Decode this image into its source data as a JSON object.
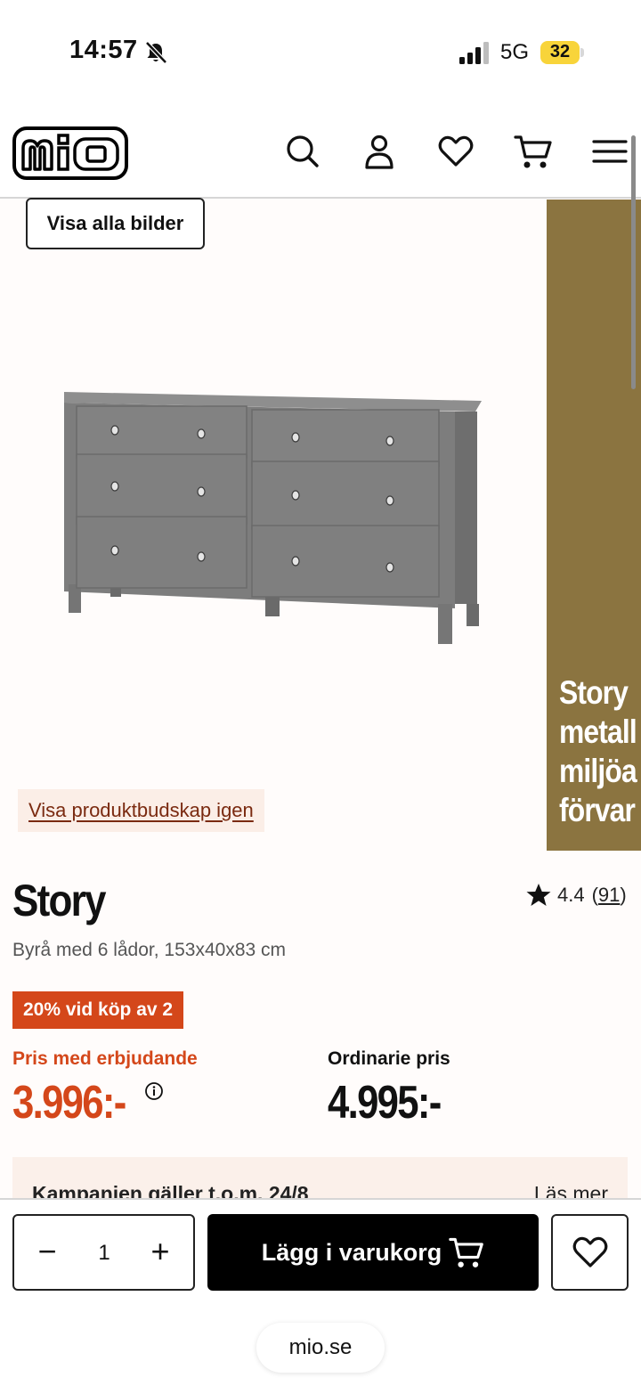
{
  "status_bar": {
    "time": "14:57",
    "network": "5G",
    "battery": "32"
  },
  "header": {
    "logo_text": "mio",
    "icons": [
      "search-icon",
      "account-icon",
      "heart-icon",
      "cart-icon",
      "menu-icon"
    ]
  },
  "gallery": {
    "show_all_label": "Visa alla bilder",
    "promo_lines": [
      "Story",
      "metall",
      "miljöa",
      "förvar"
    ],
    "reshow_label": "Visa produktbudskap igen",
    "promo_color": "#8b7440"
  },
  "product": {
    "name": "Story",
    "description": "Byrå med 6 lådor, 153x40x83 cm",
    "rating": "4.4",
    "review_count": "91",
    "badge": "20% vid köp av 2",
    "offer_label": "Pris med erbjudande",
    "offer_price": "3.996:-",
    "regular_label": "Ordinarie pris",
    "regular_price": "4.995:-",
    "campaign_text": "Kampanjen gäller t.o.m. 24/8",
    "campaign_link": "Läs mer",
    "accent_color": "#d4471a"
  },
  "bottom_bar": {
    "quantity": "1",
    "minus": "−",
    "plus": "+",
    "add_to_cart": "Lägg i varukorg",
    "url": "mio.se"
  }
}
